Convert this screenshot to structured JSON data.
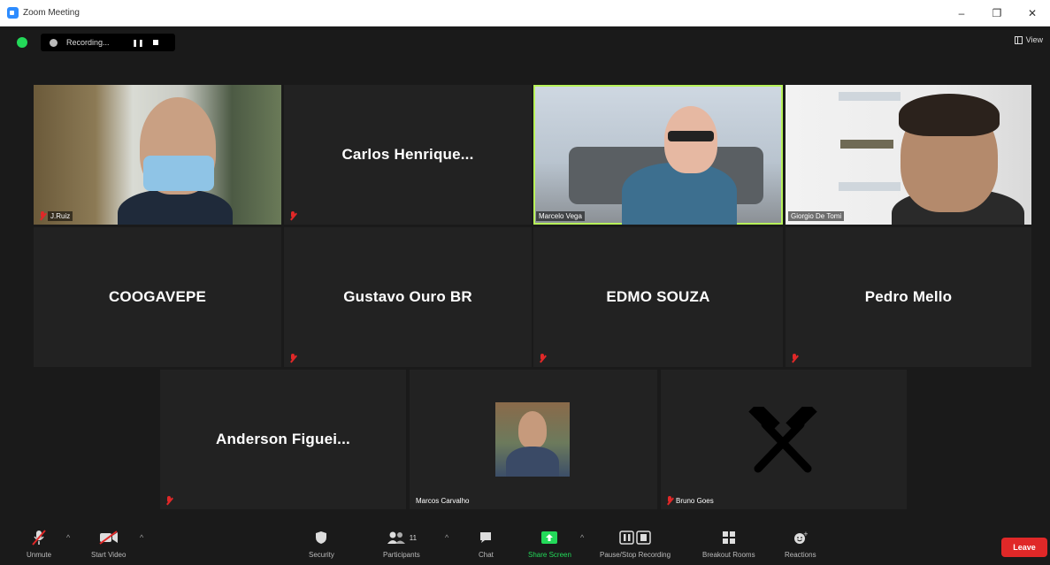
{
  "window": {
    "title": "Zoom Meeting",
    "minimize": "–",
    "maximize": "❐",
    "close": "✕"
  },
  "recording": {
    "status": "Recording...",
    "pause": "❚❚",
    "stop": ""
  },
  "view": {
    "label": "View"
  },
  "participants": [
    {
      "name": "J.Ruiz",
      "video": true
    },
    {
      "name": "Carlos Henrique...",
      "video": false
    },
    {
      "name": "Marcelo Vega",
      "video": true,
      "speaking": true
    },
    {
      "name": "Giorgio De Tomi",
      "video": true
    },
    {
      "name": "COOGAVEPE",
      "video": false
    },
    {
      "name": "Gustavo Ouro BR",
      "video": false
    },
    {
      "name": "EDMO SOUZA",
      "video": false
    },
    {
      "name": "Pedro Mello",
      "video": false
    },
    {
      "name": "Anderson Figuei...",
      "video": false
    },
    {
      "name": "Marcos Carvalho",
      "video": false
    },
    {
      "name": "Bruno Goes",
      "video": false
    }
  ],
  "toolbar": {
    "unmute": "Unmute",
    "start_video": "Start Video",
    "security": "Security",
    "participants": "Participants",
    "participants_count": "11",
    "chat": "Chat",
    "share_screen": "Share Screen",
    "pause_stop_recording": "Pause/Stop Recording",
    "breakout_rooms": "Breakout Rooms",
    "reactions": "Reactions",
    "leave": "Leave"
  },
  "colors": {
    "speaker_highlight": "#b8f35a",
    "share_green": "#23d959",
    "leave_red": "#e02828",
    "muted_red": "#e02828"
  }
}
